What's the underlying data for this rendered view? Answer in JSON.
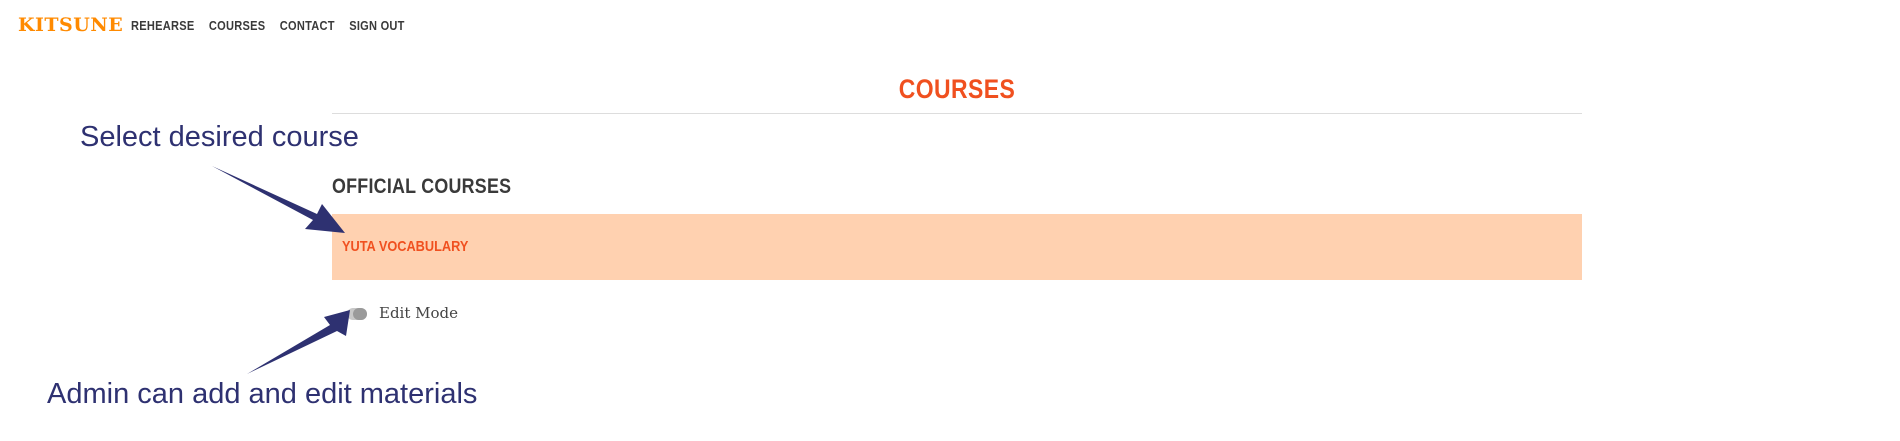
{
  "brand": {
    "logo": "KITSUNE",
    "logo_color": "#ff8a00"
  },
  "nav": {
    "items": [
      {
        "label": "REHEARSE"
      },
      {
        "label": "COURSES"
      },
      {
        "label": "CONTACT"
      },
      {
        "label": "SIGN OUT"
      }
    ]
  },
  "main": {
    "title": "COURSES",
    "section_heading": "OFFICIAL COURSES",
    "courses": [
      {
        "name": "YUTA VOCABULARY"
      }
    ],
    "edit_mode": {
      "label": "Edit Mode",
      "enabled": false
    }
  },
  "annotations": {
    "select_course": "Select desired course",
    "admin_note": "Admin can add and edit materials",
    "color": "#2e3171"
  },
  "colors": {
    "accent": "#f0501f",
    "course_row_bg": "#ffd1b0",
    "heading_text": "#3a3a3a"
  }
}
